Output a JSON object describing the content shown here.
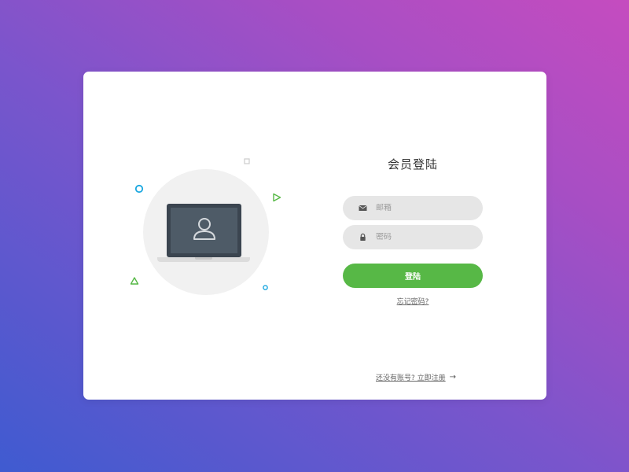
{
  "login": {
    "title": "会员登陆",
    "email": {
      "placeholder": "邮箱",
      "value": "",
      "icon": "envelope-icon"
    },
    "password": {
      "placeholder": "密码",
      "value": "",
      "icon": "lock-icon"
    },
    "submit_label": "登陆",
    "forgot_label": "忘记密码?",
    "register_label": "还没有账号? 立即注册",
    "register_arrow": "→"
  },
  "colors": {
    "primary_button": "#57b846",
    "field_background": "#e6e6e6",
    "gradient_start": "#3f5bd0",
    "gradient_end": "#c54cbf",
    "decor_blue": "#19a7e0",
    "decor_green": "#57b846"
  }
}
